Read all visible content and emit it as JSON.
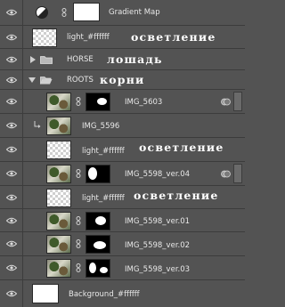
{
  "layers": [
    {
      "name": "Gradient Map"
    },
    {
      "name": "light_#ffffff",
      "note": "осветление"
    },
    {
      "name": "HORSE",
      "note": "лошадь"
    },
    {
      "name": "ROOTS",
      "note": "корни"
    },
    {
      "name": "IMG_5603"
    },
    {
      "name": "IMG_5596"
    },
    {
      "name": "light_#ffffff",
      "note": "осветление"
    },
    {
      "name": "IMG_5598_ver.04"
    },
    {
      "name": "light_#ffffff",
      "note": "осветление"
    },
    {
      "name": "IMG_5598_ver.01"
    },
    {
      "name": "IMG_5598_ver.02"
    },
    {
      "name": "IMG_5598_ver.03"
    },
    {
      "name": "Background_#ffffff"
    }
  ],
  "icons": {
    "visibility": "eye-icon",
    "link": "chain-link-icon",
    "folder": "folder-icon",
    "fx": "layer-style-icon",
    "adjustment": "gradient-map-adjustment-icon"
  },
  "colors": {
    "panel_bg": "#535353",
    "row_divider": "#3c3c3c",
    "text": "#e6e6e6",
    "annotation_text": "#ffffff"
  }
}
